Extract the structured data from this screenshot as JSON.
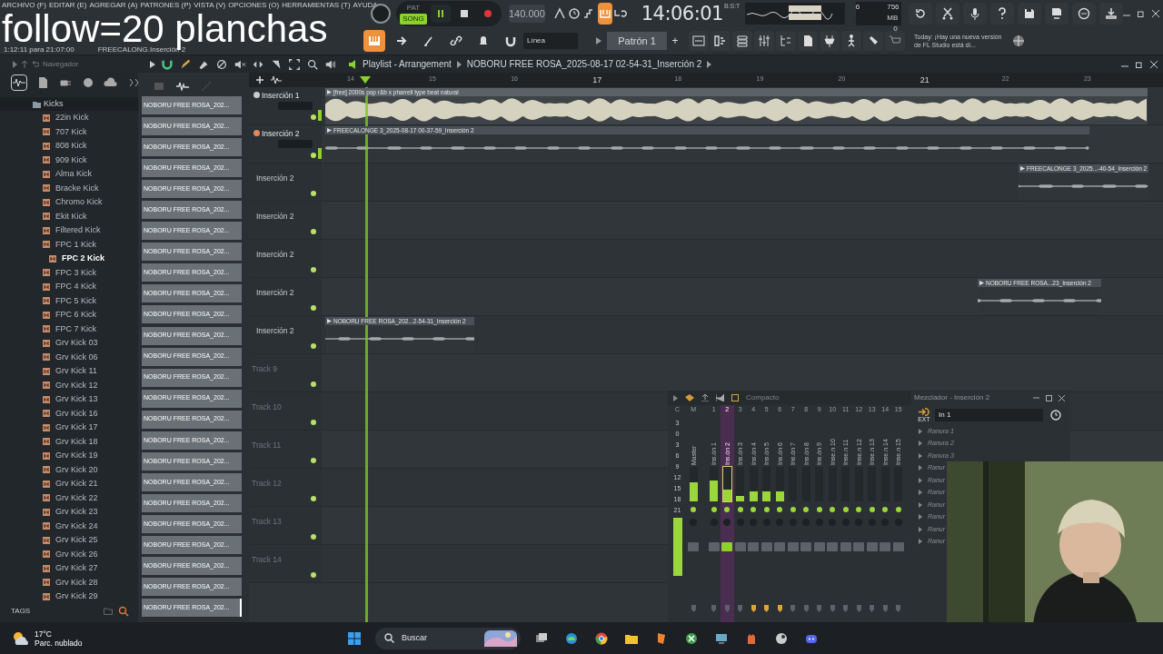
{
  "overlay_text": "follow=20 planchas",
  "menu": [
    "ARCHIVO (F)",
    "EDITAR (E)",
    "AGREGAR (A)",
    "PATRONES (P)",
    "VISTA (V)",
    "OPCIONES (O)",
    "HERRAMIENTAS (T)",
    "AYUDA"
  ],
  "transport": {
    "modes": [
      {
        "label": "PAT",
        "selected": false
      },
      {
        "label": "SONG",
        "selected": true
      }
    ],
    "playing": true,
    "recording": true,
    "tempo": "140.000",
    "time": "14:06:01",
    "time_format": "B:S:T"
  },
  "cpu": {
    "voices": "6",
    "memory": "756 MB",
    "polyphony": "0"
  },
  "hint": {
    "time": "1:12:11 para 21:07:00",
    "target": "FREECALONG.Inserción 2"
  },
  "snap": "Línea",
  "pattern": "Patrón 1",
  "pattern_add": "+",
  "news": {
    "lead": "Today:",
    "text": "¡Hay una nueva versión de FL Studio está di..."
  },
  "browser": {
    "title": "Navegador",
    "folder": "Kicks",
    "tags": "TAGS",
    "items": [
      {
        "label": "22in Kick",
        "selected": false
      },
      {
        "label": "707 Kick",
        "selected": false
      },
      {
        "label": "808 Kick",
        "selected": false
      },
      {
        "label": "909 Kick",
        "selected": false
      },
      {
        "label": "Alma Kick",
        "selected": false
      },
      {
        "label": "Bracke Kick",
        "selected": false
      },
      {
        "label": "Chromo Kick",
        "selected": false
      },
      {
        "label": "Ekit Kick",
        "selected": false
      },
      {
        "label": "Filtered Kick",
        "selected": false
      },
      {
        "label": "FPC 1 Kick",
        "selected": false
      },
      {
        "label": "FPC 2 Kick",
        "selected": true
      },
      {
        "label": "FPC 3 Kick",
        "selected": false
      },
      {
        "label": "FPC 4 Kick",
        "selected": false
      },
      {
        "label": "FPC 5 Kick",
        "selected": false
      },
      {
        "label": "FPC 6 Kick",
        "selected": false
      },
      {
        "label": "FPC 7 Kick",
        "selected": false
      },
      {
        "label": "Grv Kick 03",
        "selected": false
      },
      {
        "label": "Grv Kick 06",
        "selected": false
      },
      {
        "label": "Grv Kick 11",
        "selected": false
      },
      {
        "label": "Grv Kick 12",
        "selected": false
      },
      {
        "label": "Grv Kick 13",
        "selected": false
      },
      {
        "label": "Grv Kick 16",
        "selected": false
      },
      {
        "label": "Grv Kick 17",
        "selected": false
      },
      {
        "label": "Grv Kick 18",
        "selected": false
      },
      {
        "label": "Grv Kick 19",
        "selected": false
      },
      {
        "label": "Grv Kick 20",
        "selected": false
      },
      {
        "label": "Grv Kick 21",
        "selected": false
      },
      {
        "label": "Grv Kick 22",
        "selected": false
      },
      {
        "label": "Grv Kick 23",
        "selected": false
      },
      {
        "label": "Grv Kick 24",
        "selected": false
      },
      {
        "label": "Grv Kick 25",
        "selected": false
      },
      {
        "label": "Grv Kick 26",
        "selected": false
      },
      {
        "label": "Grv Kick 27",
        "selected": false
      },
      {
        "label": "Grv Kick 28",
        "selected": false
      },
      {
        "label": "Grv Kick 29",
        "selected": false
      }
    ]
  },
  "clip_list": [
    {
      "label": "NOBORU FREE ROSA_202...",
      "selected": false
    },
    {
      "label": "NOBORU FREE ROSA_202...",
      "selected": false
    },
    {
      "label": "NOBORU FREE ROSA_202...",
      "selected": false
    },
    {
      "label": "NOBORU FREE ROSA_202...",
      "selected": false
    },
    {
      "label": "NOBORU FREE ROSA_202...",
      "selected": false
    },
    {
      "label": "NOBORU FREE ROSA_202...",
      "selected": false
    },
    {
      "label": "NOBORU FREE ROSA_202...",
      "selected": false
    },
    {
      "label": "NOBORU FREE ROSA_202...",
      "selected": false
    },
    {
      "label": "NOBORU FREE ROSA_202...",
      "selected": false
    },
    {
      "label": "NOBORU FREE ROSA_202...",
      "selected": false
    },
    {
      "label": "NOBORU FREE ROSA_202...",
      "selected": false
    },
    {
      "label": "NOBORU FREE ROSA_202...",
      "selected": false
    },
    {
      "label": "NOBORU FREE ROSA_202...",
      "selected": false
    },
    {
      "label": "NOBORU FREE ROSA_202...",
      "selected": false
    },
    {
      "label": "NOBORU FREE ROSA_202...",
      "selected": false
    },
    {
      "label": "NOBORU FREE ROSA_202...",
      "selected": false
    },
    {
      "label": "NOBORU FREE ROSA_202...",
      "selected": false
    },
    {
      "label": "NOBORU FREE ROSA_202...",
      "selected": false
    },
    {
      "label": "NOBORU FREE ROSA_202...",
      "selected": false
    },
    {
      "label": "NOBORU FREE ROSA_202...",
      "selected": false
    },
    {
      "label": "NOBORU FREE ROSA_202...",
      "selected": false
    },
    {
      "label": "NOBORU FREE ROSA_202...",
      "selected": false
    },
    {
      "label": "NOBORU FREE ROSA_202...",
      "selected": false
    },
    {
      "label": "NOBORU FREE ROSA_202...",
      "selected": false
    },
    {
      "label": "NOBORU FREE ROSA_202...",
      "selected": true
    }
  ],
  "playlist": {
    "title": "Playlist - Arrangement",
    "path": "NOBORU FREE ROSA_2025-08-17 02-54-31_Inserción 2",
    "ruler": [
      "14",
      "15",
      "16",
      "17",
      "18",
      "19",
      "20",
      "21",
      "22",
      "23"
    ],
    "tracks": [
      {
        "name": "Inserción 1",
        "kind": "controls",
        "clips": [
          {
            "label": "[free] 2000s pop r&b x pharrell type beat  natural",
            "kind": "loud"
          }
        ]
      },
      {
        "name": "Inserción 2",
        "kind": "controls",
        "clips": [
          {
            "label": "FREECALONGE 3_2025-08-17 00-37-59_Inserción 2",
            "kind": "quiet"
          }
        ]
      },
      {
        "name": "Inserción 2",
        "kind": "plain",
        "clips": [
          {
            "label": "FREECALONGE 3_2025...-40-54_Inserción 2",
            "kind": "quiet"
          }
        ]
      },
      {
        "name": "Inserción 2",
        "kind": "plain"
      },
      {
        "name": "Inserción 2",
        "kind": "plain"
      },
      {
        "name": "Inserción 2",
        "kind": "plain",
        "clips": [
          {
            "label": "NOBORU FREE ROSA...23_Inserción 2",
            "kind": "quiet"
          }
        ]
      },
      {
        "name": "Inserción 2",
        "kind": "plain",
        "clips": [
          {
            "label": "NOBORU FREE ROSA_202...2-54-31_Inserción 2",
            "kind": "quiet"
          }
        ]
      },
      {
        "name": "Track 9",
        "kind": "empty"
      },
      {
        "name": "Track 10",
        "kind": "empty"
      },
      {
        "name": "Track 11",
        "kind": "empty"
      },
      {
        "name": "Track 12",
        "kind": "empty"
      },
      {
        "name": "Track 13",
        "kind": "empty"
      },
      {
        "name": "Track 14",
        "kind": "empty"
      }
    ]
  },
  "mixer": {
    "view": "Compacto",
    "current": "C",
    "scale": [
      "3",
      "0",
      "3",
      "6",
      "9",
      "12",
      "15",
      "18",
      "21"
    ],
    "channels": [
      {
        "number": "M",
        "label": "Master",
        "level": 0.55,
        "selected": false
      },
      {
        "number": "1",
        "label": "Ins.ón 1",
        "level": 0.6,
        "selected": false
      },
      {
        "number": "2",
        "label": "Ins.ón 2",
        "level": 0.35,
        "selected": true
      },
      {
        "number": "3",
        "label": "Ins.ón 3",
        "level": 0.17,
        "selected": false
      },
      {
        "number": "4",
        "label": "Ins.ón 4",
        "level": 0.3,
        "selected": false
      },
      {
        "number": "5",
        "label": "Ins.ón 5",
        "level": 0.3,
        "selected": false
      },
      {
        "number": "6",
        "label": "Ins.ón 6",
        "level": 0.3,
        "selected": false
      },
      {
        "number": "7",
        "label": "Ins.ón 7",
        "selected": false
      },
      {
        "number": "8",
        "label": "Ins.ón 8",
        "selected": false
      },
      {
        "number": "9",
        "label": "Ins.ón 9",
        "selected": false
      },
      {
        "number": "10",
        "label": "Inse.n 10",
        "selected": false
      },
      {
        "number": "11",
        "label": "Inse.n 11",
        "selected": false
      },
      {
        "number": "12",
        "label": "Inse.n 12",
        "selected": false
      },
      {
        "number": "13",
        "label": "Inse.n 13",
        "selected": false
      },
      {
        "number": "14",
        "label": "Inse.n 14",
        "selected": false
      },
      {
        "number": "15",
        "label": "Inse.n 15",
        "selected": false
      }
    ]
  },
  "insert_panel": {
    "title": "Mezclador - Inserción 2",
    "input": "In 1",
    "input_tag": "EXT",
    "slots": [
      "Ranura 1",
      "Ranura 2",
      "Ranura 3",
      "Ranur",
      "Ranur",
      "Ranur",
      "Ranur",
      "Ranur",
      "Ranur",
      "Ranur"
    ]
  },
  "taskbar": {
    "temperature": "17°C",
    "weather": "Parc. nublado",
    "search": "Buscar"
  }
}
